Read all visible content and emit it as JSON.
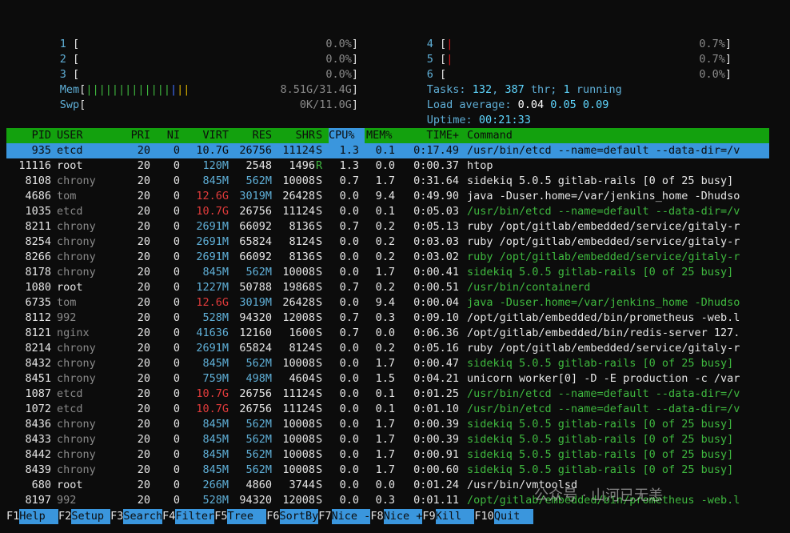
{
  "cpus": [
    {
      "id": "1",
      "value": "0.0%",
      "bar": ""
    },
    {
      "id": "2",
      "value": "0.0%",
      "bar": ""
    },
    {
      "id": "3",
      "value": "0.0%",
      "bar": ""
    },
    {
      "id": "4",
      "value": "0.7%",
      "bar": "|"
    },
    {
      "id": "5",
      "value": "0.7%",
      "bar": "|"
    },
    {
      "id": "6",
      "value": "0.0%",
      "bar": ""
    }
  ],
  "mem": {
    "label": "Mem",
    "bar_green": "|||||||||||||",
    "bar_blue": "|",
    "bar_yellow": "||",
    "value": "8.51G/31.4G"
  },
  "swp": {
    "label": "Swp",
    "value": "0K/11.0G"
  },
  "tasks": {
    "label": "Tasks:",
    "count": "132",
    "sep1": ",",
    "thr": "387",
    "thr_label": "thr;",
    "running": "1",
    "running_label": "running"
  },
  "load": {
    "label": "Load average:",
    "v1": "0.04",
    "v2": "0.05",
    "v3": "0.09"
  },
  "uptime": {
    "label": "Uptime:",
    "value": "00:21:33"
  },
  "columns": {
    "pid": "PID",
    "user": "USER",
    "pri": "PRI",
    "ni": "NI",
    "virt": "VIRT",
    "res": "RES",
    "shr": "SHR",
    "s": "S",
    "cpu": "CPU%",
    "mem": "MEM%",
    "time": "TIME+",
    "cmd": "Command"
  },
  "processes": [
    {
      "pid": "935",
      "user": "etcd",
      "pri": "20",
      "ni": "0",
      "virt": "10.7G",
      "res": "26756",
      "shr": "11124",
      "s": "S",
      "cpu": "1.3",
      "mem": "0.1",
      "time": "0:17.49",
      "cmd": "/usr/bin/etcd --name=default --data-dir=/v"
    },
    {
      "pid": "11116",
      "user": "root",
      "pri": "20",
      "ni": "0",
      "virt": "120M",
      "res": "2548",
      "shr": "1496",
      "s": "R",
      "cpu": "1.3",
      "mem": "0.0",
      "time": "0:00.37",
      "cmd": "htop"
    },
    {
      "pid": "8108",
      "user": "chrony",
      "pri": "20",
      "ni": "0",
      "virt": "845M",
      "res": "562M",
      "shr": "10008",
      "s": "S",
      "cpu": "0.7",
      "mem": "1.7",
      "time": "0:31.64",
      "cmd": "sidekiq 5.0.5 gitlab-rails [0 of 25 busy]"
    },
    {
      "pid": "4686",
      "user": "tom",
      "pri": "20",
      "ni": "0",
      "virt": "12.6G",
      "res": "3019M",
      "shr": "26428",
      "s": "S",
      "cpu": "0.0",
      "mem": "9.4",
      "time": "0:49.90",
      "cmd": "java -Duser.home=/var/jenkins_home -Dhudso"
    },
    {
      "pid": "1035",
      "user": "etcd",
      "pri": "20",
      "ni": "0",
      "virt": "10.7G",
      "res": "26756",
      "shr": "11124",
      "s": "S",
      "cpu": "0.0",
      "mem": "0.1",
      "time": "0:05.03",
      "cmd": "/usr/bin/etcd --name=default --data-dir=/v"
    },
    {
      "pid": "8211",
      "user": "chrony",
      "pri": "20",
      "ni": "0",
      "virt": "2691M",
      "res": "66092",
      "shr": "8136",
      "s": "S",
      "cpu": "0.7",
      "mem": "0.2",
      "time": "0:05.13",
      "cmd": "ruby /opt/gitlab/embedded/service/gitaly-r"
    },
    {
      "pid": "8254",
      "user": "chrony",
      "pri": "20",
      "ni": "0",
      "virt": "2691M",
      "res": "65824",
      "shr": "8124",
      "s": "S",
      "cpu": "0.0",
      "mem": "0.2",
      "time": "0:03.03",
      "cmd": "ruby /opt/gitlab/embedded/service/gitaly-r"
    },
    {
      "pid": "8266",
      "user": "chrony",
      "pri": "20",
      "ni": "0",
      "virt": "2691M",
      "res": "66092",
      "shr": "8136",
      "s": "S",
      "cpu": "0.0",
      "mem": "0.2",
      "time": "0:03.02",
      "cmd": "ruby /opt/gitlab/embedded/service/gitaly-r"
    },
    {
      "pid": "8178",
      "user": "chrony",
      "pri": "20",
      "ni": "0",
      "virt": "845M",
      "res": "562M",
      "shr": "10008",
      "s": "S",
      "cpu": "0.0",
      "mem": "1.7",
      "time": "0:00.41",
      "cmd": "sidekiq 5.0.5 gitlab-rails [0 of 25 busy]"
    },
    {
      "pid": "1080",
      "user": "root",
      "pri": "20",
      "ni": "0",
      "virt": "1227M",
      "res": "50788",
      "shr": "19868",
      "s": "S",
      "cpu": "0.7",
      "mem": "0.2",
      "time": "0:00.51",
      "cmd": "/usr/bin/containerd"
    },
    {
      "pid": "6735",
      "user": "tom",
      "pri": "20",
      "ni": "0",
      "virt": "12.6G",
      "res": "3019M",
      "shr": "26428",
      "s": "S",
      "cpu": "0.0",
      "mem": "9.4",
      "time": "0:00.04",
      "cmd": "java -Duser.home=/var/jenkins_home -Dhudso"
    },
    {
      "pid": "8112",
      "user": "992",
      "pri": "20",
      "ni": "0",
      "virt": "528M",
      "res": "94320",
      "shr": "12008",
      "s": "S",
      "cpu": "0.7",
      "mem": "0.3",
      "time": "0:09.10",
      "cmd": "/opt/gitlab/embedded/bin/prometheus -web.l"
    },
    {
      "pid": "8121",
      "user": "nginx",
      "pri": "20",
      "ni": "0",
      "virt": "41636",
      "res": "12160",
      "shr": "1600",
      "s": "S",
      "cpu": "0.7",
      "mem": "0.0",
      "time": "0:06.36",
      "cmd": "/opt/gitlab/embedded/bin/redis-server 127."
    },
    {
      "pid": "8214",
      "user": "chrony",
      "pri": "20",
      "ni": "0",
      "virt": "2691M",
      "res": "65824",
      "shr": "8124",
      "s": "S",
      "cpu": "0.0",
      "mem": "0.2",
      "time": "0:05.16",
      "cmd": "ruby /opt/gitlab/embedded/service/gitaly-r"
    },
    {
      "pid": "8432",
      "user": "chrony",
      "pri": "20",
      "ni": "0",
      "virt": "845M",
      "res": "562M",
      "shr": "10008",
      "s": "S",
      "cpu": "0.0",
      "mem": "1.7",
      "time": "0:00.47",
      "cmd": "sidekiq 5.0.5 gitlab-rails [0 of 25 busy]"
    },
    {
      "pid": "8451",
      "user": "chrony",
      "pri": "20",
      "ni": "0",
      "virt": "759M",
      "res": "498M",
      "shr": "4604",
      "s": "S",
      "cpu": "0.0",
      "mem": "1.5",
      "time": "0:04.21",
      "cmd": "unicorn worker[0] -D -E production -c /var"
    },
    {
      "pid": "1087",
      "user": "etcd",
      "pri": "20",
      "ni": "0",
      "virt": "10.7G",
      "res": "26756",
      "shr": "11124",
      "s": "S",
      "cpu": "0.0",
      "mem": "0.1",
      "time": "0:01.25",
      "cmd": "/usr/bin/etcd --name=default --data-dir=/v"
    },
    {
      "pid": "1072",
      "user": "etcd",
      "pri": "20",
      "ni": "0",
      "virt": "10.7G",
      "res": "26756",
      "shr": "11124",
      "s": "S",
      "cpu": "0.0",
      "mem": "0.1",
      "time": "0:01.10",
      "cmd": "/usr/bin/etcd --name=default --data-dir=/v"
    },
    {
      "pid": "8436",
      "user": "chrony",
      "pri": "20",
      "ni": "0",
      "virt": "845M",
      "res": "562M",
      "shr": "10008",
      "s": "S",
      "cpu": "0.0",
      "mem": "1.7",
      "time": "0:00.39",
      "cmd": "sidekiq 5.0.5 gitlab-rails [0 of 25 busy]"
    },
    {
      "pid": "8433",
      "user": "chrony",
      "pri": "20",
      "ni": "0",
      "virt": "845M",
      "res": "562M",
      "shr": "10008",
      "s": "S",
      "cpu": "0.0",
      "mem": "1.7",
      "time": "0:00.39",
      "cmd": "sidekiq 5.0.5 gitlab-rails [0 of 25 busy]"
    },
    {
      "pid": "8442",
      "user": "chrony",
      "pri": "20",
      "ni": "0",
      "virt": "845M",
      "res": "562M",
      "shr": "10008",
      "s": "S",
      "cpu": "0.0",
      "mem": "1.7",
      "time": "0:00.91",
      "cmd": "sidekiq 5.0.5 gitlab-rails [0 of 25 busy]"
    },
    {
      "pid": "8439",
      "user": "chrony",
      "pri": "20",
      "ni": "0",
      "virt": "845M",
      "res": "562M",
      "shr": "10008",
      "s": "S",
      "cpu": "0.0",
      "mem": "1.7",
      "time": "0:00.60",
      "cmd": "sidekiq 5.0.5 gitlab-rails [0 of 25 busy]"
    },
    {
      "pid": "680",
      "user": "root",
      "pri": "20",
      "ni": "0",
      "virt": "266M",
      "res": "4860",
      "shr": "3744",
      "s": "S",
      "cpu": "0.0",
      "mem": "0.0",
      "time": "0:01.24",
      "cmd": "/usr/bin/vmtoolsd"
    },
    {
      "pid": "8197",
      "user": "992",
      "pri": "20",
      "ni": "0",
      "virt": "528M",
      "res": "94320",
      "shr": "12008",
      "s": "S",
      "cpu": "0.0",
      "mem": "0.3",
      "time": "0:01.11",
      "cmd": "/opt/gitlab/embedded/bin/prometheus -web.l"
    }
  ],
  "fkeys": [
    {
      "key": "F1",
      "label": "Help  "
    },
    {
      "key": "F2",
      "label": "Setup "
    },
    {
      "key": "F3",
      "label": "Search"
    },
    {
      "key": "F4",
      "label": "Filter"
    },
    {
      "key": "F5",
      "label": "Tree  "
    },
    {
      "key": "F6",
      "label": "SortBy"
    },
    {
      "key": "F7",
      "label": "Nice -"
    },
    {
      "key": "F8",
      "label": "Nice +"
    },
    {
      "key": "F9",
      "label": "Kill  "
    },
    {
      "key": "F10",
      "label": "Quit  "
    }
  ],
  "watermark": "公众号 · 山河已无恙"
}
